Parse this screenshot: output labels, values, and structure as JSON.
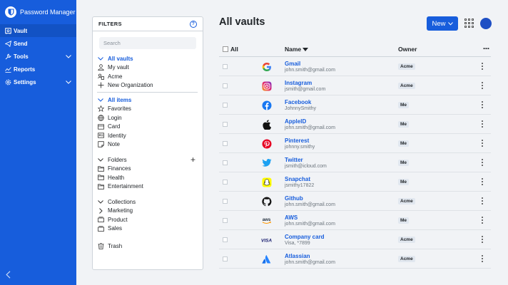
{
  "app": {
    "title": "Password Manager"
  },
  "nav": {
    "items": [
      {
        "label": "Vault",
        "icon": "vault-icon",
        "active": true
      },
      {
        "label": "Send",
        "icon": "send-icon",
        "active": false
      },
      {
        "label": "Tools",
        "icon": "wrench-icon",
        "active": false,
        "chevron": true
      },
      {
        "label": "Reports",
        "icon": "reports-icon",
        "active": false
      },
      {
        "label": "Settings",
        "icon": "gear-icon",
        "active": false,
        "chevron": true
      }
    ]
  },
  "filters": {
    "title": "FILTERS",
    "search_placeholder": "Search",
    "vaults": {
      "header": "All vaults",
      "items": [
        "My vault",
        "Acme",
        "New Organization"
      ]
    },
    "items": {
      "header": "All items",
      "entries": [
        "Favorites",
        "Login",
        "Card",
        "Identity",
        "Note"
      ]
    },
    "folders": {
      "header": "Folders",
      "entries": [
        "Finances",
        "Health",
        "Entertainment"
      ]
    },
    "collections": {
      "header": "Collections",
      "entries": [
        "Marketing",
        "Product",
        "Sales"
      ]
    },
    "trash": "Trash"
  },
  "main": {
    "title": "All vaults",
    "new_label": "New",
    "columns": {
      "all": "All",
      "name": "Name",
      "owner": "Owner"
    },
    "rows": [
      {
        "name": "Gmail",
        "sub": "john.smith@gmail.com",
        "owner": "Acme",
        "icon": "google-icon"
      },
      {
        "name": "Instagram",
        "sub": "jsmith@gmail.com",
        "owner": "Acme",
        "icon": "instagram-icon"
      },
      {
        "name": "Facebook",
        "sub": "JohnnySmithy",
        "owner": "Me",
        "icon": "facebook-icon"
      },
      {
        "name": "AppleID",
        "sub": "john.smith@gmail.com",
        "owner": "Me",
        "icon": "apple-icon"
      },
      {
        "name": "Pinterest",
        "sub": "johnny.smithy",
        "owner": "Me",
        "icon": "pinterest-icon"
      },
      {
        "name": "Twitter",
        "sub": "jsmith@icloud.com",
        "owner": "Me",
        "icon": "twitter-icon"
      },
      {
        "name": "Snapchat",
        "sub": "jsmithy17822",
        "owner": "Me",
        "icon": "snapchat-icon"
      },
      {
        "name": "Github",
        "sub": "john.smith@gmail.com",
        "owner": "Acme",
        "icon": "github-icon"
      },
      {
        "name": "AWS",
        "sub": "john.smith@gmail.com",
        "owner": "Me",
        "icon": "aws-icon"
      },
      {
        "name": "Company card",
        "sub": "Visa, *7899",
        "owner": "Acme",
        "icon": "visa-icon"
      },
      {
        "name": "Atlassian",
        "sub": "john.smith@gmail.com",
        "owner": "Acme",
        "icon": "atlassian-icon"
      }
    ]
  },
  "colors": {
    "brand": "#175ddc",
    "badge_bg": "#e1e7ef"
  }
}
